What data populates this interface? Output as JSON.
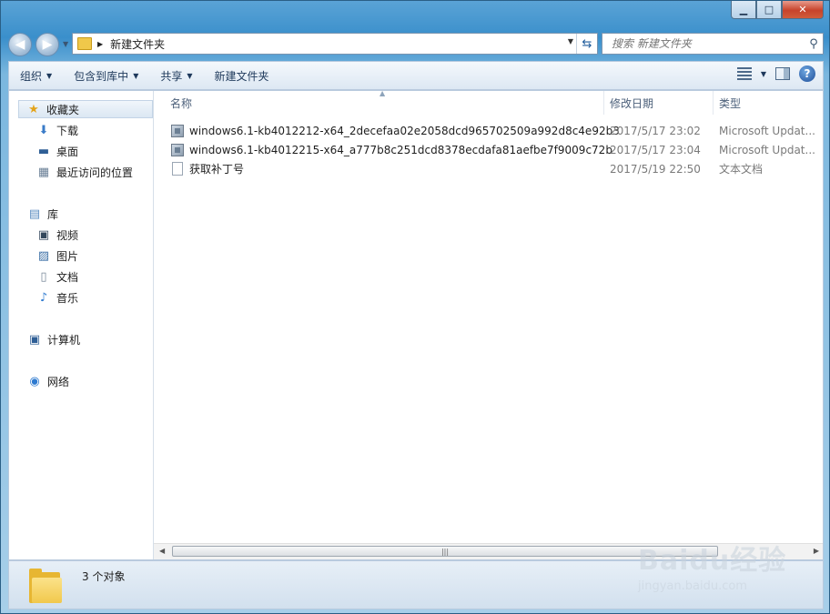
{
  "address": {
    "path": "新建文件夹",
    "search_placeholder": "搜索 新建文件夹"
  },
  "toolbar": {
    "organize": "组织",
    "include_library": "包含到库中",
    "share": "共享",
    "new_folder": "新建文件夹"
  },
  "nav": {
    "favorites": "收藏夹",
    "downloads": "下载",
    "desktop": "桌面",
    "recent": "最近访问的位置",
    "libraries": "库",
    "videos": "视频",
    "pictures": "图片",
    "documents": "文档",
    "music": "音乐",
    "computer": "计算机",
    "network": "网络"
  },
  "columns": {
    "name": "名称",
    "date": "修改日期",
    "type": "类型"
  },
  "files": [
    {
      "name": "windows6.1-kb4012212-x64_2decefaa02e2058dcd965702509a992d8c4e92b3",
      "date": "2017/5/17 23:02",
      "type": "Microsoft Updat...",
      "icon": "msu-icon"
    },
    {
      "name": "windows6.1-kb4012215-x64_a777b8c251dcd8378ecdafa81aefbe7f9009c72b",
      "date": "2017/5/17 23:04",
      "type": "Microsoft Updat...",
      "icon": "msu-icon"
    },
    {
      "name": "获取补丁号",
      "date": "2017/5/19 22:50",
      "type": "文本文档",
      "icon": "text-file-icon"
    }
  ],
  "status": {
    "count": "3 个对象"
  },
  "watermark": {
    "brand": "Baidu经验",
    "url": "jingyan.baidu.com"
  }
}
